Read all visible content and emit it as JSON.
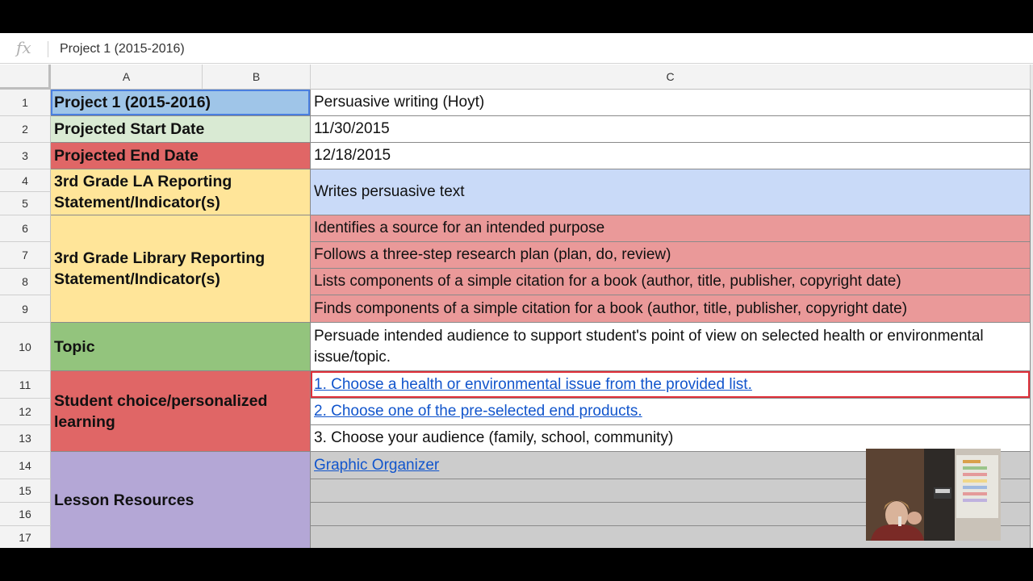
{
  "formula_bar": {
    "fx_symbol": "fx",
    "value": "Project 1 (2015-2016)"
  },
  "columns": [
    "A",
    "B",
    "C"
  ],
  "rows": [
    "1",
    "2",
    "3",
    "4",
    "5",
    "6",
    "7",
    "8",
    "9",
    "10",
    "11",
    "12",
    "13",
    "14",
    "15",
    "16",
    "17"
  ],
  "labels": {
    "project": "Project 1 (2015-2016)",
    "start": "Projected Start Date",
    "end": "Projected End Date",
    "la": "3rd Grade LA Reporting Statement/Indicator(s)",
    "library": "3rd Grade Library Reporting Statement/Indicator(s)",
    "topic": "Topic",
    "choice": "Student choice/personalized learning",
    "resources": "Lesson Resources"
  },
  "values": {
    "project": "Persuasive writing (Hoyt)",
    "start": "11/30/2015",
    "end": "12/18/2015",
    "la": "Writes persuasive text",
    "library": [
      "Identifies a source for an intended purpose",
      "Follows a three-step research plan (plan, do, review)",
      "Lists components of a simple citation for a book (author, title, publisher, copyright date)",
      "Finds components of a simple citation for a book (author, title, publisher, copyright date)"
    ],
    "topic": "Persuade intended audience to support student's point of view on selected health or environmental issue/topic.",
    "choice": [
      "1. Choose a health or environmental issue from the provided list. ",
      "2. Choose one of the pre-selected end products. ",
      "3. Choose your audience (family, school, community)"
    ],
    "resources": [
      "Graphic Organizer"
    ]
  },
  "colors": {
    "blue": "#9fc5e8",
    "green_light": "#d9ead3",
    "red": "#e06666",
    "yellow": "#ffe599",
    "periwinkle": "#c9daf8",
    "pink": "#ea9999",
    "green": "#93c47d",
    "purple": "#b4a7d6",
    "gray": "#cccccc",
    "link": "#1155cc"
  }
}
